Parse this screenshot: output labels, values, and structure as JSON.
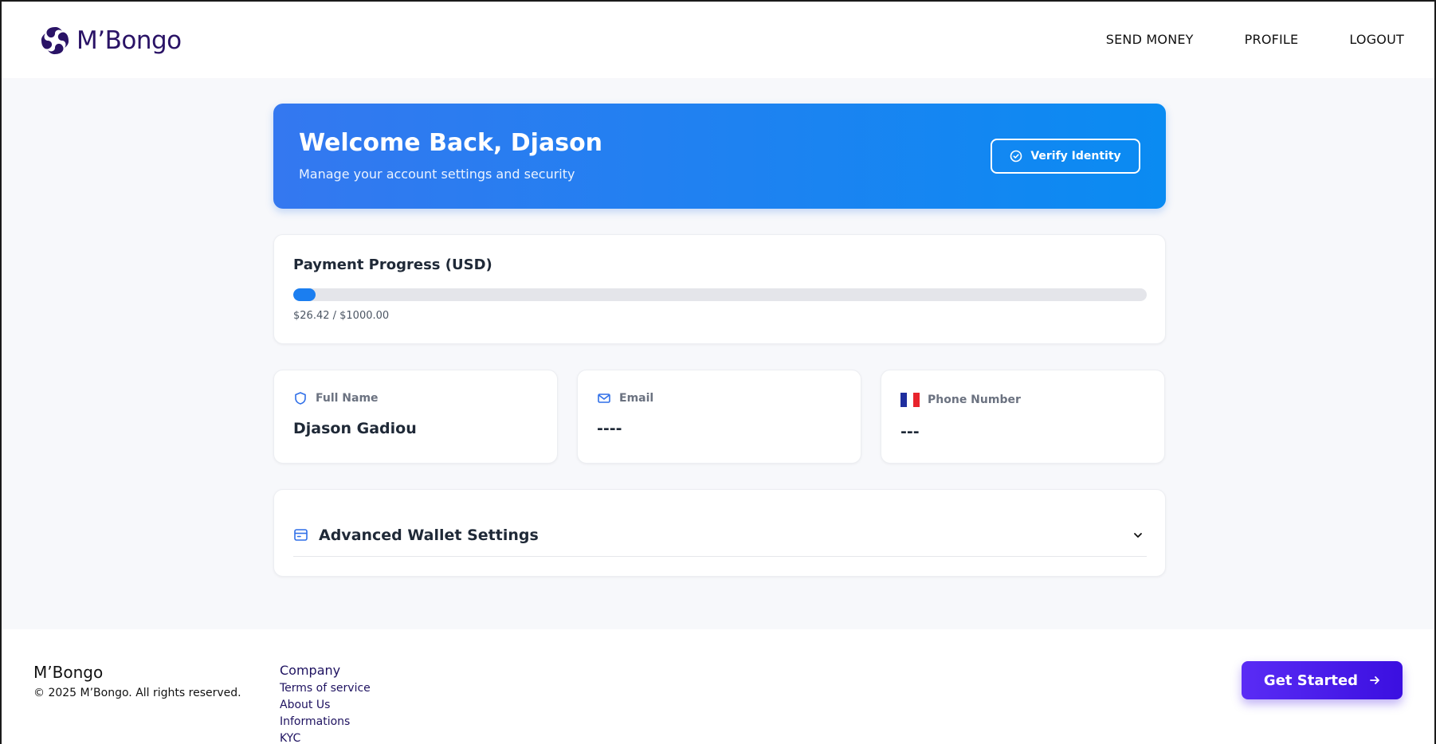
{
  "app": {
    "brand": "M’Bongo"
  },
  "nav": {
    "items": [
      "SEND MONEY",
      "PROFILE",
      "LOGOUT"
    ]
  },
  "hero": {
    "title": "Welcome Back, Djason",
    "subtitle": "Manage your account settings and security",
    "verify_label": "Verify Identity"
  },
  "progress": {
    "title": "Payment Progress (USD)",
    "amount_text": "$26.42 / $1000.00",
    "current": 26.42,
    "goal": 1000.0
  },
  "info": {
    "full_name_label": "Full Name",
    "full_name_value": "Djason Gadiou",
    "email_label": "Email",
    "email_value": "----",
    "phone_label": "Phone Number",
    "phone_value": "---"
  },
  "advanced": {
    "title": "Advanced Wallet Settings"
  },
  "footer": {
    "brand": "M’Bongo",
    "copyright": "© 2025 M’Bongo. All rights reserved.",
    "company_heading": "Company",
    "links": [
      "Terms of service",
      "About Us",
      "Informations",
      "KYC"
    ],
    "cta_label": "Get Started"
  },
  "colors": {
    "brand_dark": "#2a1366",
    "hero_start": "#3478f0",
    "hero_end": "#0a8bf2",
    "progress_fill": "#1b7ef0",
    "cta_start": "#5a2cf5",
    "cta_end": "#3b0fe0"
  },
  "icons": {
    "logo": "swirl-logo-icon",
    "verify": "check-circle-icon",
    "full_name": "shield-icon",
    "email": "mail-icon",
    "phone": "france-flag-icon",
    "advanced": "wallet-icon",
    "advanced_toggle": "chevron-down-icon",
    "cta": "arrow-right-icon"
  }
}
